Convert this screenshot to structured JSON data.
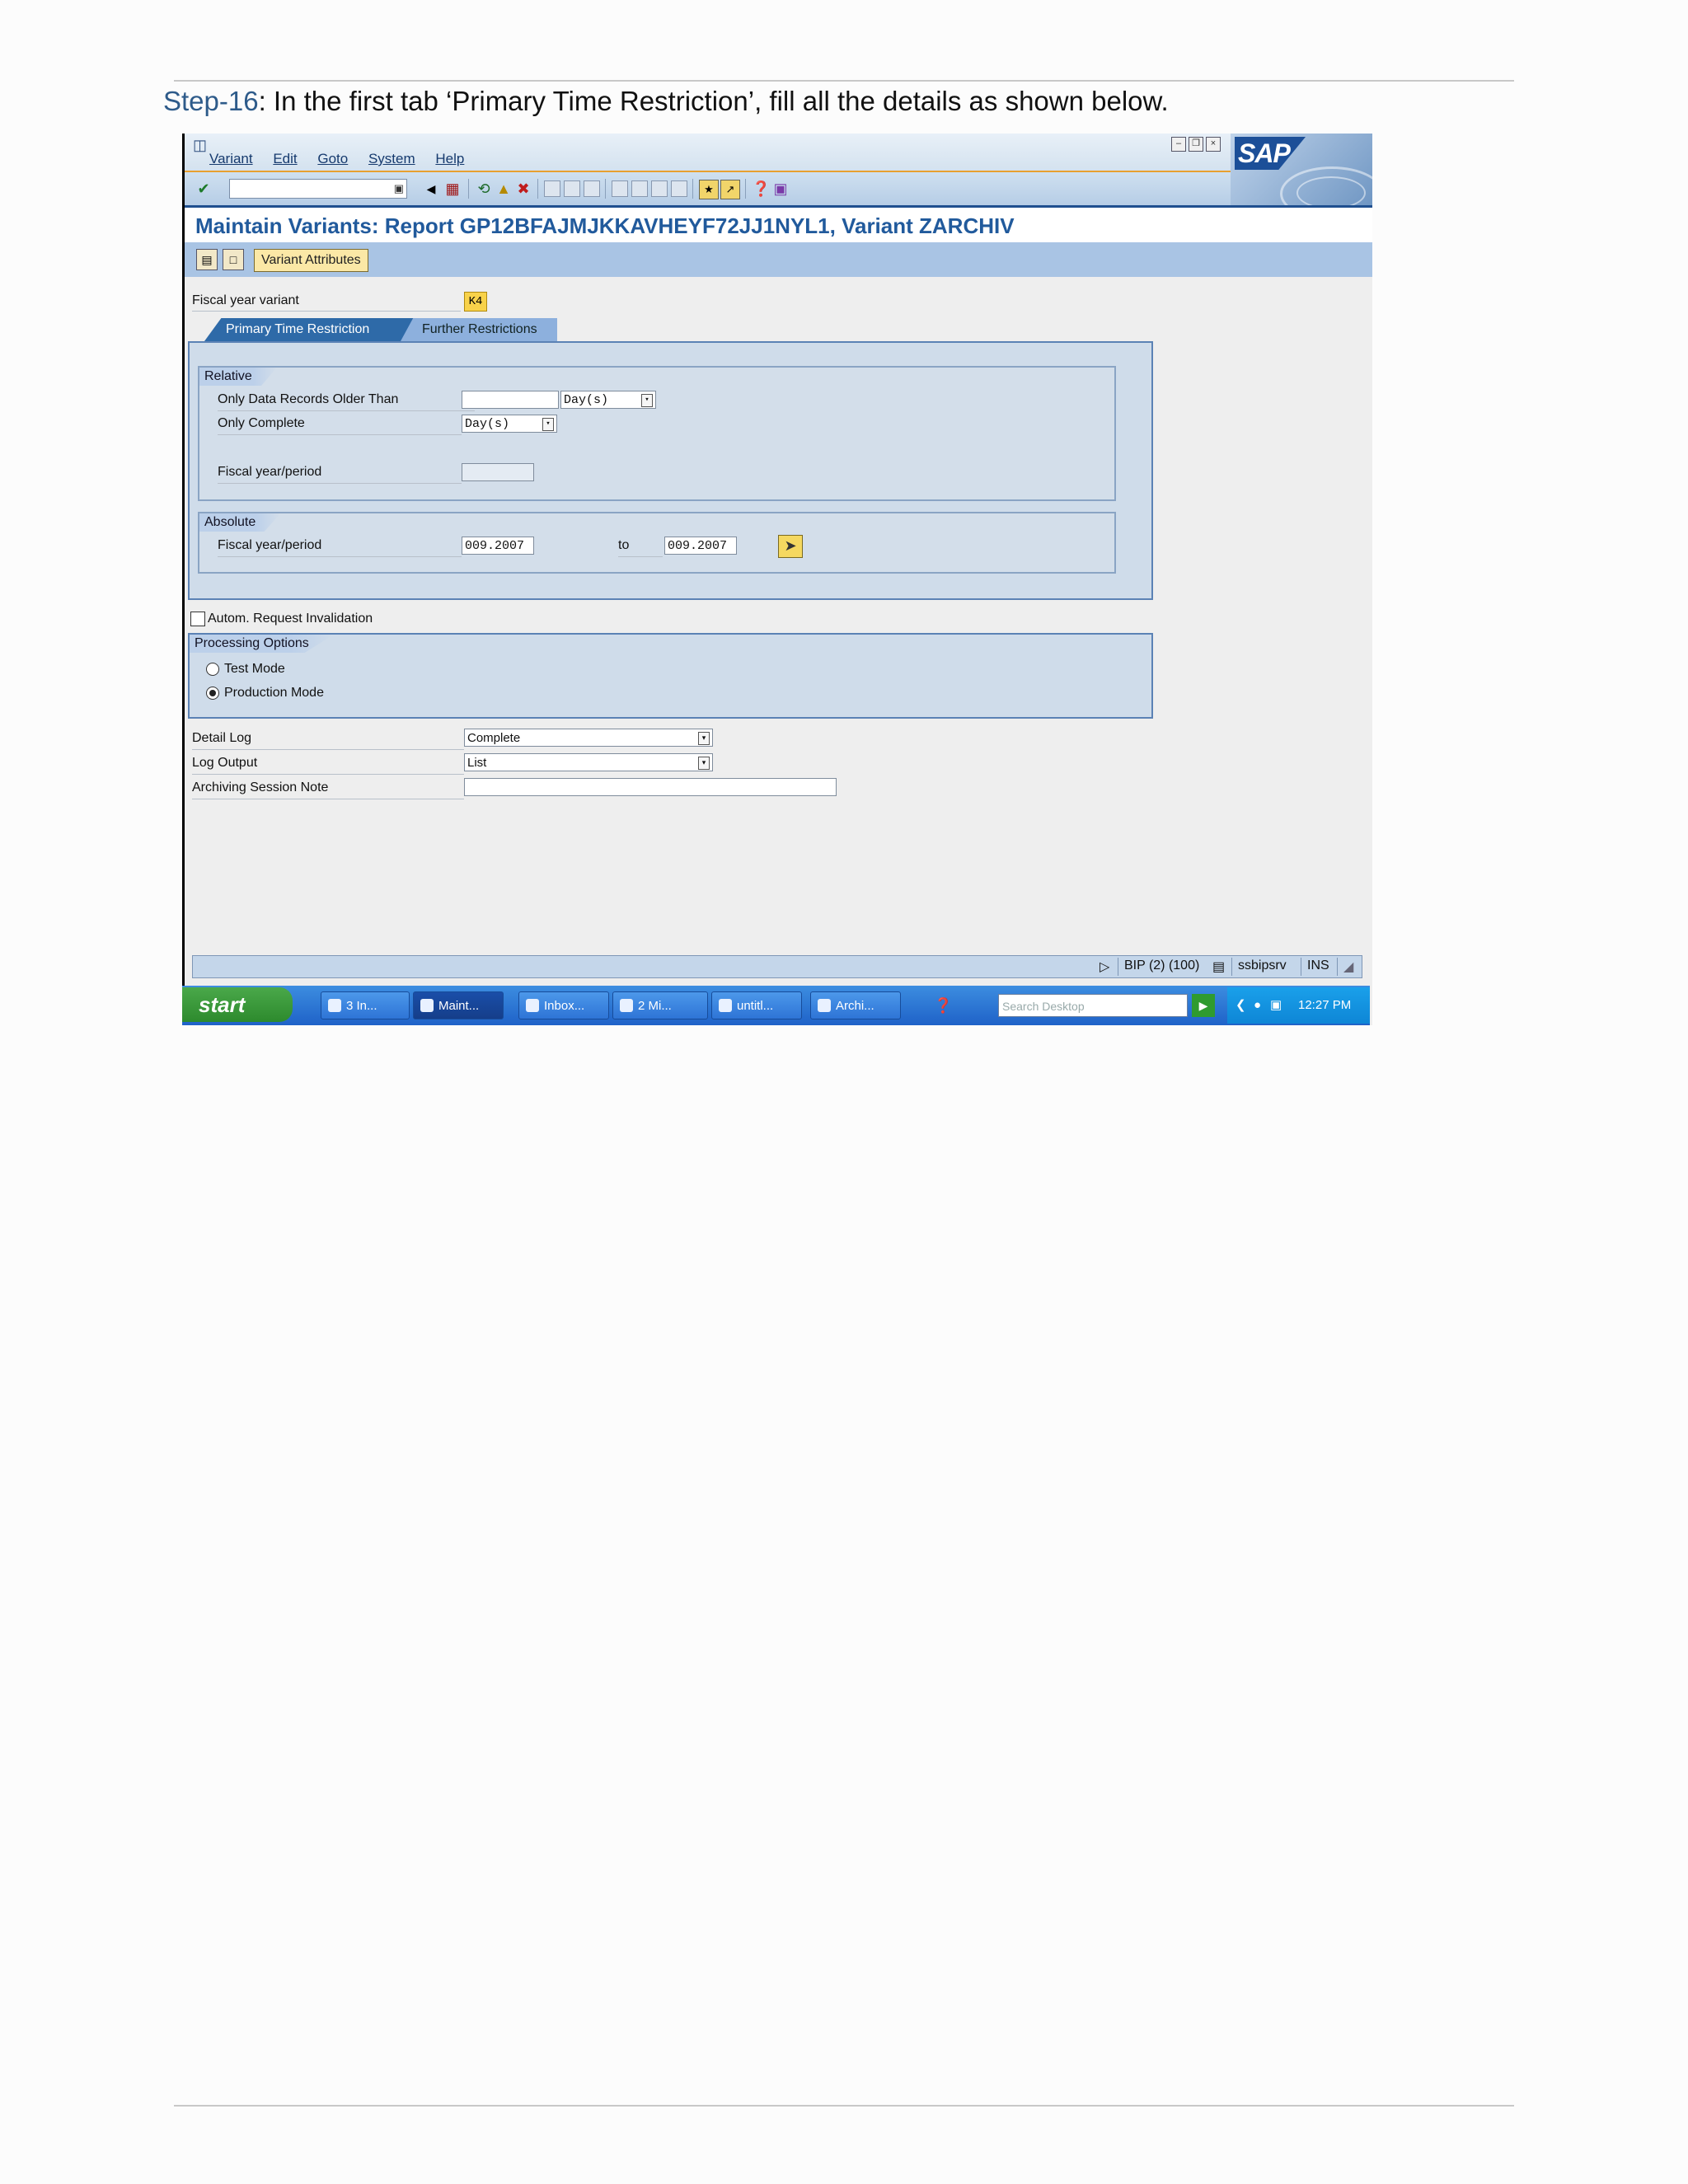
{
  "doc": {
    "step_label": "Step-16",
    "step_text": ": In the first tab ‘Primary Time Restriction’, fill all the details as shown below."
  },
  "sap": {
    "menu": [
      "Variant",
      "Edit",
      "Goto",
      "System",
      "Help"
    ],
    "brand": "SAP",
    "title": "Maintain Variants: Report GP12BFAJMJKKAVHEYF72JJ1NYL1, Variant ZARCHIV",
    "variant_attributes_label": "Variant Attributes",
    "fiscal_year_variant_label": "Fiscal year variant",
    "fiscal_year_variant_value": "K4",
    "tabs": [
      "Primary Time Restriction",
      "Further Restrictions"
    ],
    "relative": {
      "title": "Relative",
      "older_than_label": "Only Data Records Older Than",
      "older_than_value": "",
      "older_than_unit": "Day(s)",
      "only_complete_label": "Only Complete",
      "only_complete_unit": "Day(s)",
      "fiscal_period_label": "Fiscal year/period",
      "fiscal_period_value": ""
    },
    "absolute": {
      "title": "Absolute",
      "fiscal_period_label": "Fiscal year/period",
      "from": "009.2007",
      "to_label": "to",
      "to": "009.2007"
    },
    "autom_request_label": "Autom. Request Invalidation",
    "autom_request_checked": false,
    "processing": {
      "title": "Processing Options",
      "test_mode_label": "Test Mode",
      "production_mode_label": "Production Mode",
      "selected": "Production Mode"
    },
    "detail_log_label": "Detail Log",
    "detail_log_value": "Complete",
    "log_output_label": "Log Output",
    "log_output_value": "List",
    "archiving_note_label": "Archiving Session Note",
    "archiving_note_value": "",
    "status": {
      "system": "BIP (2) (100)",
      "server": "ssbipsrv",
      "mode": "INS"
    }
  },
  "taskbar": {
    "start": "start",
    "tasks": [
      "3 In...",
      "Maint...",
      "Inbox...",
      "2 Mi...",
      "untitl...",
      "Archi..."
    ],
    "search_placeholder": "Search Desktop",
    "clock": "12:27 PM"
  }
}
